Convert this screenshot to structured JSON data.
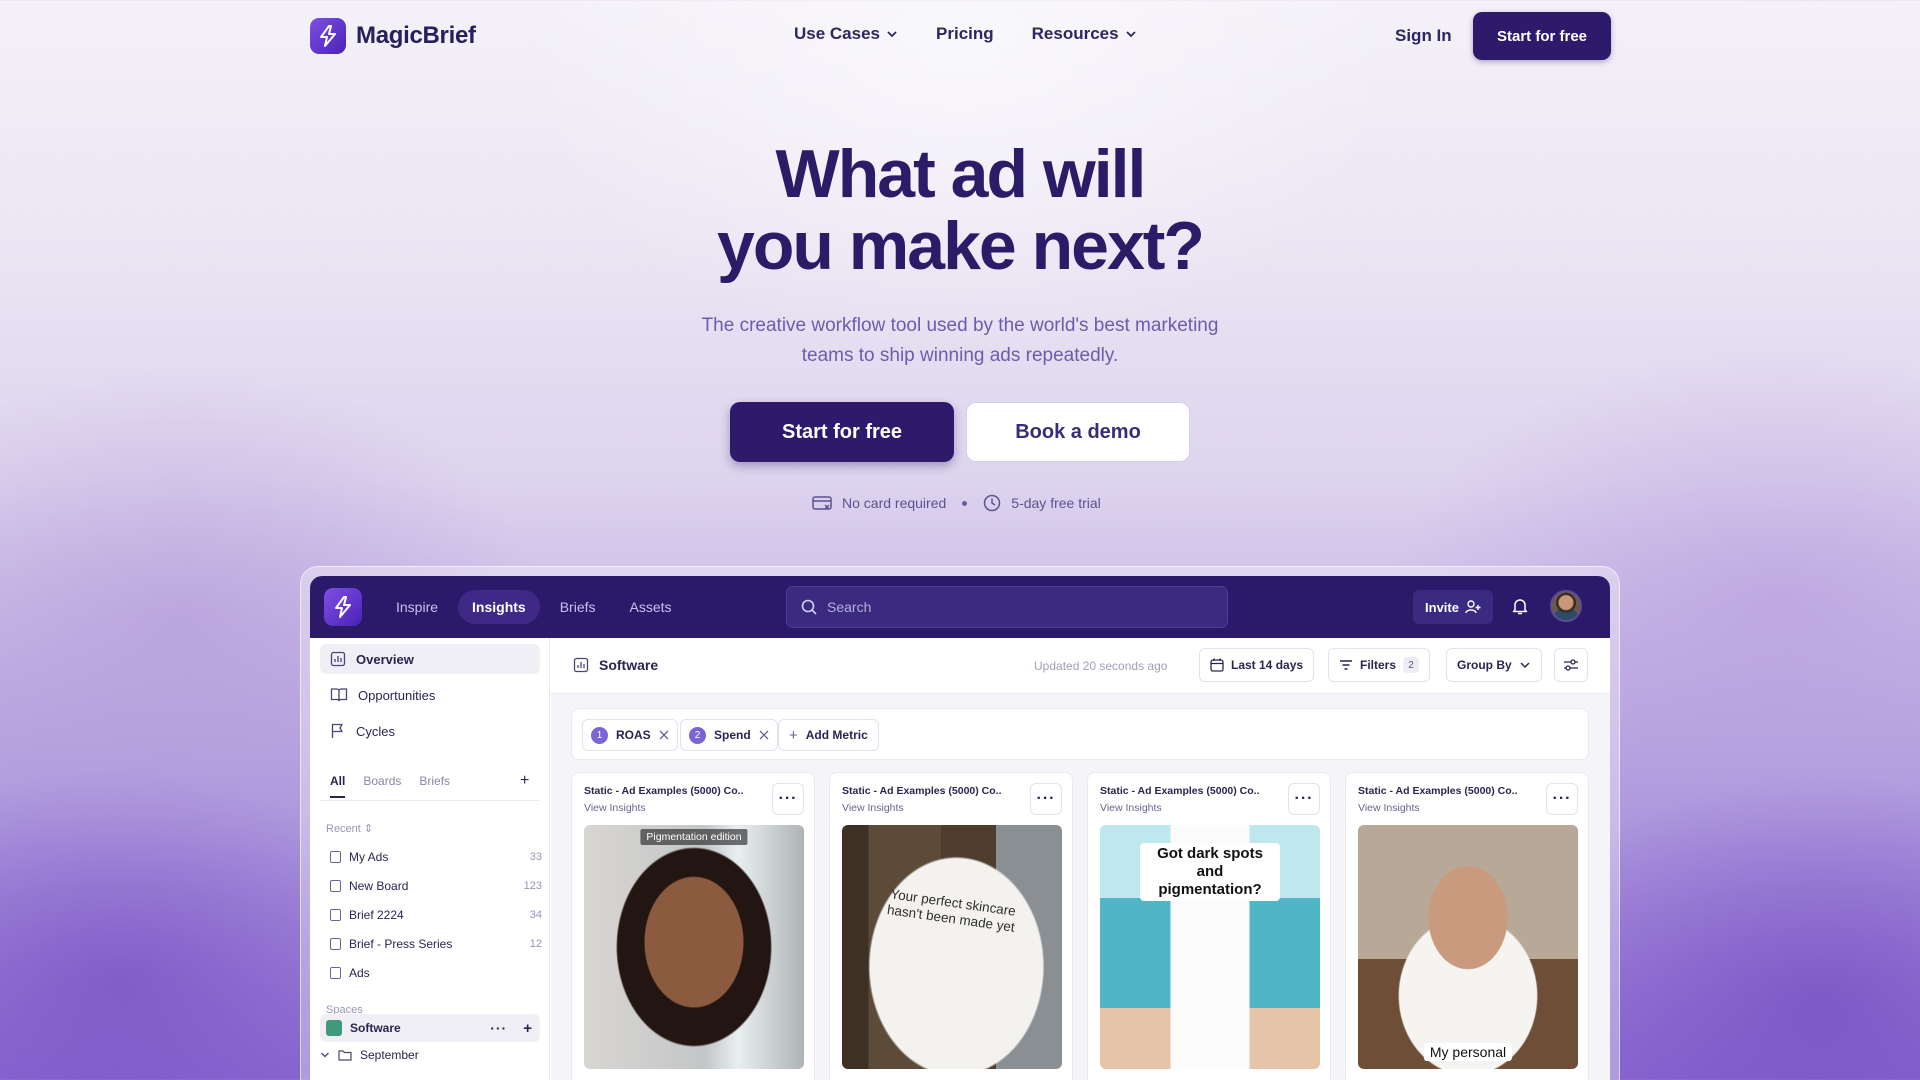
{
  "brand": {
    "name": "MagicBrief",
    "accent": "#2e1a6b",
    "accent_light": "#7e4fe6"
  },
  "nav": {
    "links": [
      {
        "label": "Use Cases",
        "dropdown": true
      },
      {
        "label": "Pricing",
        "dropdown": false
      },
      {
        "label": "Resources",
        "dropdown": true
      }
    ],
    "sign_in": "Sign In",
    "cta": "Start for free"
  },
  "hero": {
    "title_line1": "What ad will",
    "title_line2": "you make next?",
    "subtitle_line1": "The creative workflow tool used by the world's best marketing",
    "subtitle_line2": "teams to ship winning ads repeatedly.",
    "cta_primary": "Start for free",
    "cta_secondary": "Book a demo",
    "perk1": "No card required",
    "perk2": "5-day free trial"
  },
  "app": {
    "tabs": [
      {
        "label": "Inspire",
        "active": false
      },
      {
        "label": "Insights",
        "active": true
      },
      {
        "label": "Briefs",
        "active": false
      },
      {
        "label": "Assets",
        "active": false
      }
    ],
    "search_placeholder": "Search",
    "invite": "Invite",
    "sidebar": {
      "nav": [
        {
          "label": "Overview",
          "icon": "chart-icon",
          "active": true
        },
        {
          "label": "Opportunities",
          "icon": "book-icon",
          "active": false
        },
        {
          "label": "Cycles",
          "icon": "flag-icon",
          "active": false
        }
      ],
      "tabs": [
        "All",
        "Boards",
        "Briefs"
      ],
      "recent_heading": "Recent",
      "recent": [
        {
          "label": "My Ads",
          "count": "33"
        },
        {
          "label": "New Board",
          "count": "123"
        },
        {
          "label": "Brief 2224",
          "count": "34"
        },
        {
          "label": "Brief - Press Series",
          "count": "12"
        },
        {
          "label": "Ads",
          "count": ""
        }
      ],
      "spaces_heading": "Spaces",
      "space": "Software",
      "folder": "September"
    },
    "main": {
      "title": "Software",
      "updated": "Updated 20 seconds ago",
      "date_range": "Last 14 days",
      "filters": "Filters",
      "filters_count": "2",
      "group_by": "Group By",
      "metrics": [
        {
          "n": "1",
          "label": "ROAS"
        },
        {
          "n": "2",
          "label": "Spend"
        }
      ],
      "add_metric": "Add Metric",
      "cards": [
        {
          "title": "Static - Ad Examples (5000) Co..",
          "link": "View Insights",
          "overlay": "Pigmentation edition"
        },
        {
          "title": "Static - Ad Examples (5000) Co..",
          "link": "View Insights",
          "overlay": "Your perfect skincare hasn't been made yet"
        },
        {
          "title": "Static - Ad Examples (5000) Co..",
          "link": "View Insights",
          "overlay": "Got dark spots and pigmentation?"
        },
        {
          "title": "Static - Ad Examples (5000) Co..",
          "link": "View Insights",
          "overlay": "My personal"
        }
      ]
    }
  }
}
